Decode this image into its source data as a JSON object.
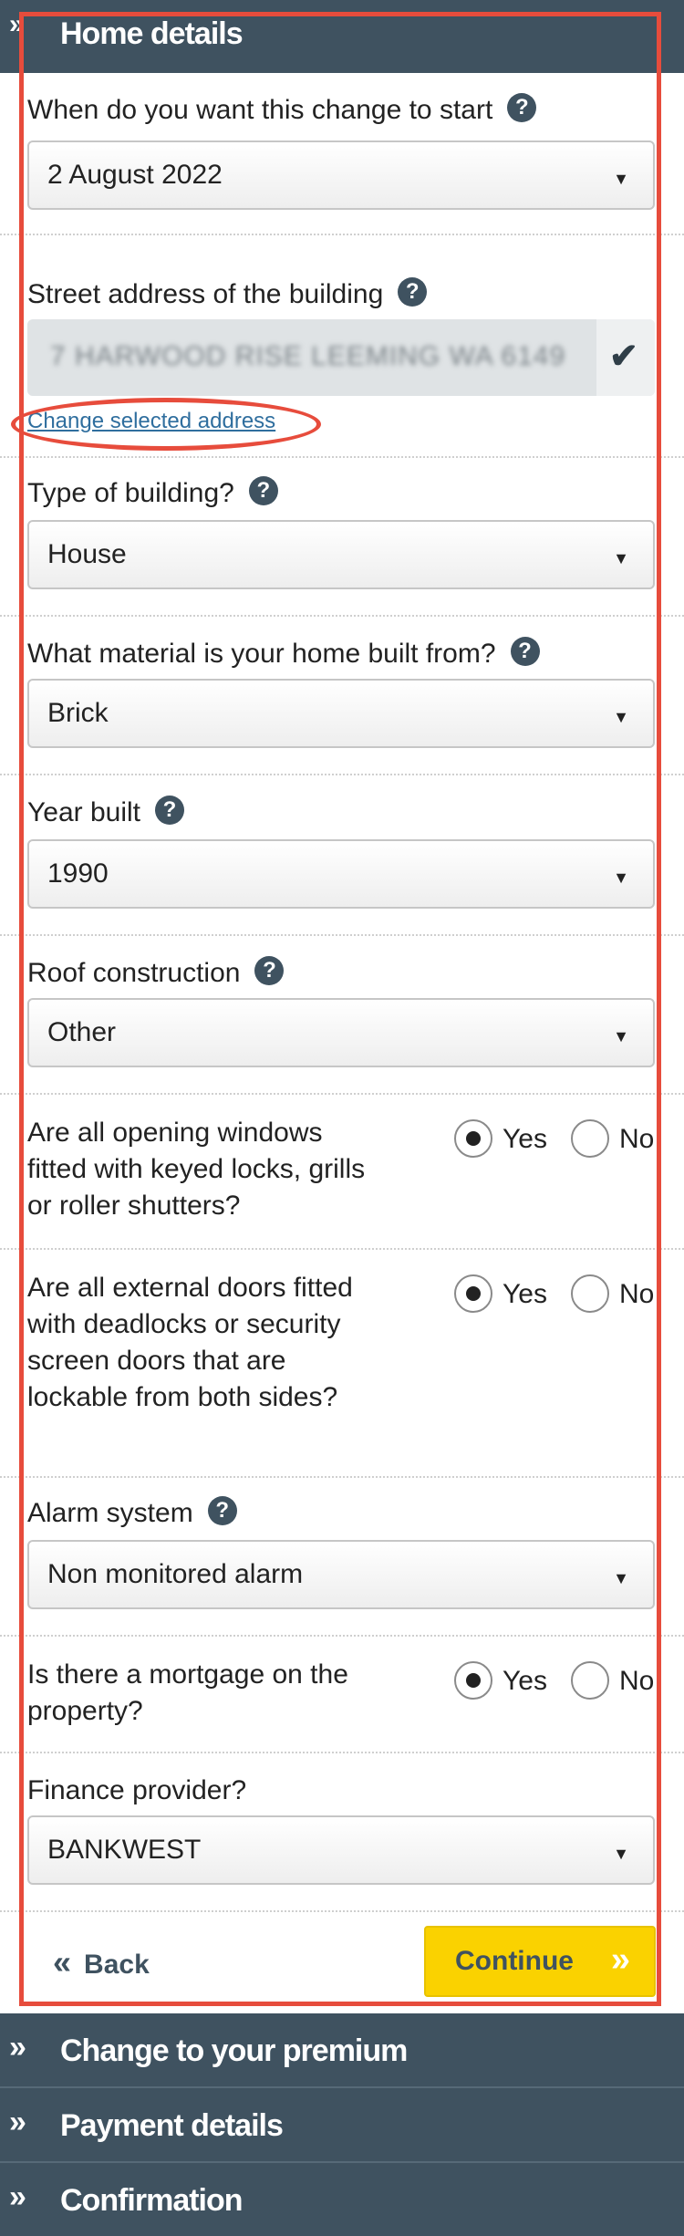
{
  "header": {
    "title": "Home details",
    "chevron": "»"
  },
  "start_date": {
    "label": "When do you want this change to start",
    "value": "2 August 2022"
  },
  "address": {
    "label": "Street address of the building",
    "value": "7 HARWOOD RISE LEEMING WA 6149",
    "change_link": "Change selected address"
  },
  "building_type": {
    "label": "Type of building?",
    "value": "House"
  },
  "material": {
    "label": "What material is your home built from?",
    "value": "Brick"
  },
  "year_built": {
    "label": "Year built",
    "value": "1990"
  },
  "roof": {
    "label": "Roof construction",
    "value": "Other"
  },
  "windows": {
    "question": "Are all opening windows fitted with keyed locks, grills or roller shutters?",
    "yes": "Yes",
    "no": "No",
    "selected": "Yes"
  },
  "doors": {
    "question": "Are all external doors fitted with deadlocks or security screen doors that are lockable from both sides?",
    "yes": "Yes",
    "no": "No",
    "selected": "Yes"
  },
  "alarm": {
    "label": "Alarm system",
    "value": "Non monitored alarm"
  },
  "mortgage": {
    "question": "Is there a mortgage on the property?",
    "yes": "Yes",
    "no": "No",
    "selected": "Yes"
  },
  "finance": {
    "label": "Finance provider?",
    "value": "BANKWEST"
  },
  "actions": {
    "back": "Back",
    "continue": "Continue"
  },
  "sections": [
    {
      "title": "Change to your premium"
    },
    {
      "title": "Payment details"
    },
    {
      "title": "Confirmation"
    }
  ],
  "help_symbol": "?",
  "caret_symbol": "▼",
  "colors": {
    "header": "#3f5260",
    "continue": "#fad200",
    "highlight": "#e74c3c"
  }
}
